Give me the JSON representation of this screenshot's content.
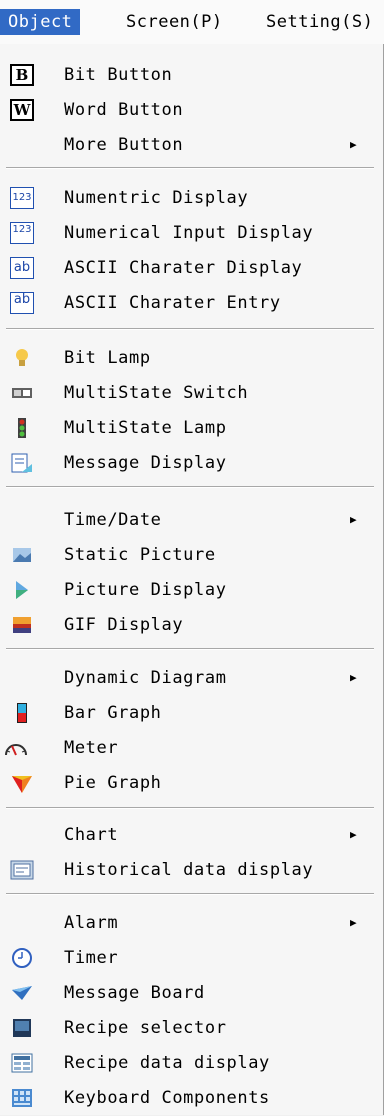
{
  "menubar": {
    "object": "Object",
    "screen": "Screen(P)",
    "setting": "Setting(S)"
  },
  "menu": {
    "bit_button": "Bit Button",
    "bit_button_icon": "B",
    "word_button": "Word Button",
    "word_button_icon": "W",
    "more_button": "More Button",
    "numeric_display": "Numentric Display",
    "numeric_display_icon": "123",
    "numerical_input": "Numerical Input Display",
    "numerical_input_icon": "123",
    "ascii_display": "ASCII Charater Display",
    "ascii_display_icon": "ab",
    "ascii_entry": "ASCII Charater Entry",
    "ascii_entry_icon": "ab",
    "bit_lamp": "Bit Lamp",
    "multistate_switch": "MultiState Switch",
    "multistate_lamp": "MultiState Lamp",
    "message_display": "Message Display",
    "time_date": "Time/Date",
    "static_picture": "Static Picture",
    "picture_display": "Picture Display",
    "gif_display": "GIF Display",
    "dynamic_diagram": "Dynamic Diagram",
    "bar_graph": "Bar Graph",
    "meter": "Meter",
    "pie_graph": "Pie Graph",
    "chart": "Chart",
    "historical_data": "Historical data display",
    "alarm": "Alarm",
    "timer": "Timer",
    "message_board": "Message Board",
    "recipe_selector": "Recipe selector",
    "recipe_data": "Recipe data display",
    "keyboard_components": "Keyboard Components",
    "submenu_arrow": "▶"
  }
}
